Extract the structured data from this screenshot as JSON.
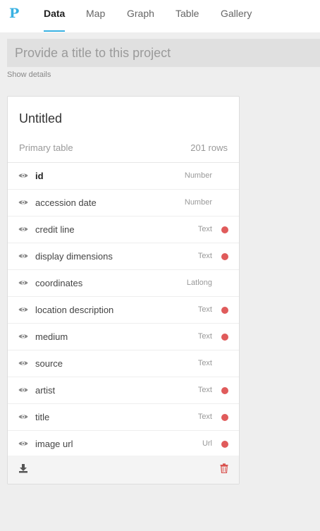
{
  "nav": {
    "logo": "P",
    "tabs": [
      {
        "label": "Data",
        "active": true
      },
      {
        "label": "Map",
        "active": false
      },
      {
        "label": "Graph",
        "active": false
      },
      {
        "label": "Table",
        "active": false
      },
      {
        "label": "Gallery",
        "active": false
      }
    ],
    "accent_color": "#39b1e2"
  },
  "project": {
    "title_value": "",
    "title_placeholder": "Provide a title to this project",
    "show_details": "Show details"
  },
  "card": {
    "title": "Untitled",
    "table_label": "Primary table",
    "row_count": "201 rows",
    "columns": [
      {
        "name": "id",
        "type": "Number",
        "flag": false,
        "bold": true
      },
      {
        "name": "accession date",
        "type": "Number",
        "flag": false,
        "bold": false
      },
      {
        "name": "credit line",
        "type": "Text",
        "flag": true,
        "bold": false
      },
      {
        "name": "display dimensions",
        "type": "Text",
        "flag": true,
        "bold": false
      },
      {
        "name": "coordinates",
        "type": "Latlong",
        "flag": false,
        "bold": false
      },
      {
        "name": "location description",
        "type": "Text",
        "flag": true,
        "bold": false
      },
      {
        "name": "medium",
        "type": "Text",
        "flag": true,
        "bold": false
      },
      {
        "name": "source",
        "type": "Text",
        "flag": false,
        "bold": false
      },
      {
        "name": "artist",
        "type": "Text",
        "flag": true,
        "bold": false
      },
      {
        "name": "title",
        "type": "Text",
        "flag": true,
        "bold": false
      },
      {
        "name": "image url",
        "type": "Url",
        "flag": true,
        "bold": false
      }
    ],
    "icons": {
      "visibility": "eye-icon",
      "download": "download-icon",
      "delete": "trash-icon"
    },
    "flag_color": "#e05b5b",
    "delete_color": "#d9534f"
  }
}
